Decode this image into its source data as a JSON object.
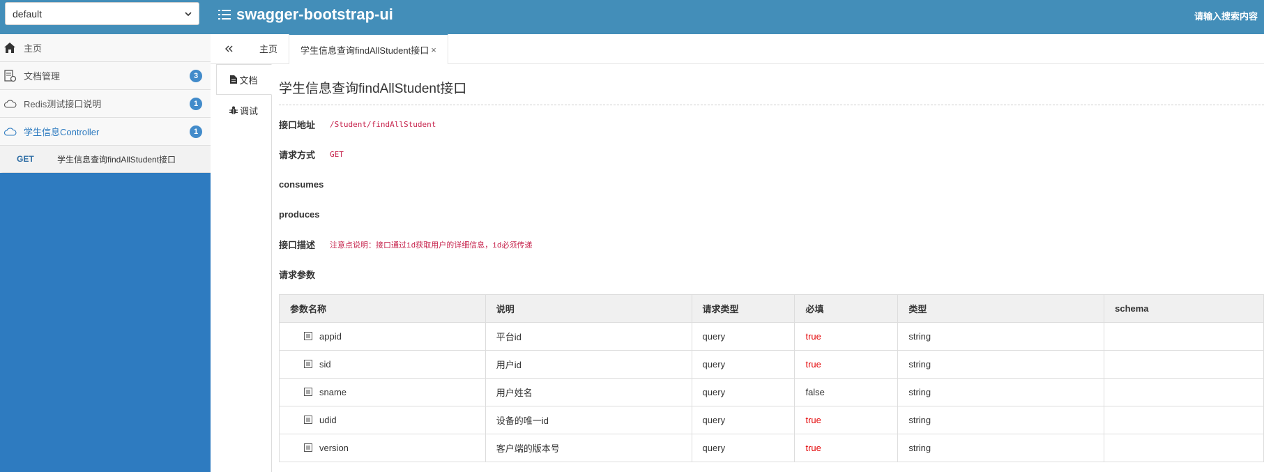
{
  "header": {
    "group_select": "default",
    "brand": "swagger-bootstrap-ui",
    "search_hint": "请输入搜索内容"
  },
  "sidebar": {
    "items": [
      {
        "label": "主页",
        "icon": "home-icon",
        "badge": ""
      },
      {
        "label": "文档管理",
        "icon": "doc-manage-icon",
        "badge": "3"
      },
      {
        "label": "Redis测试接口说明",
        "icon": "cloud-icon",
        "badge": "1"
      },
      {
        "label": "学生信息Controller",
        "icon": "cloud-icon",
        "badge": "1"
      }
    ],
    "sub": {
      "method": "GET",
      "label": "学生信息查询findAllStudent接口"
    }
  },
  "tabs": {
    "items": [
      {
        "label": "主页"
      },
      {
        "label": "学生信息查询findAllStudent接口",
        "close": "×"
      }
    ]
  },
  "vtabs": {
    "doc": "文档",
    "debug": "调试"
  },
  "api": {
    "title": "学生信息查询findAllStudent接口",
    "rows": [
      {
        "key": "接口地址",
        "value": "/Student/findAllStudent"
      },
      {
        "key": "请求方式",
        "value": "GET"
      },
      {
        "key": "consumes",
        "value": ""
      },
      {
        "key": "produces",
        "value": ""
      },
      {
        "key": "接口描述",
        "value": "注意点说明：接口通过id获取用户的详细信息，id必须传递"
      },
      {
        "key": "请求参数",
        "value": ""
      }
    ]
  },
  "params_table": {
    "headers": [
      "参数名称",
      "说明",
      "请求类型",
      "必填",
      "类型",
      "schema"
    ],
    "rows": [
      [
        "appid",
        "平台id",
        "query",
        "true",
        "string",
        ""
      ],
      [
        "sid",
        "用户id",
        "query",
        "true",
        "string",
        ""
      ],
      [
        "sname",
        "用户姓名",
        "query",
        "false",
        "string",
        ""
      ],
      [
        "udid",
        "设备的唯一id",
        "query",
        "true",
        "string",
        ""
      ],
      [
        "version",
        "客户端的版本号",
        "query",
        "true",
        "string",
        ""
      ]
    ]
  },
  "colors": {
    "header_bg": "#438eb9",
    "sidebar_bg": "#2e7bc0",
    "badge": "#428bca",
    "code_red": "#c7254e",
    "required_red": "#e4080a"
  }
}
